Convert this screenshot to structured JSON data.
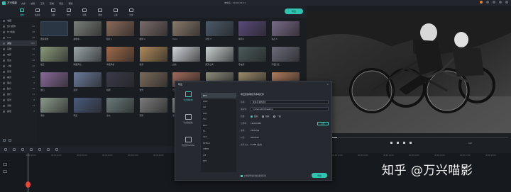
{
  "titlebar": {
    "app_name": "万兴喵影",
    "menus": [
      "文件",
      "编辑",
      "工具",
      "查看",
      "导出",
      "帮助"
    ],
    "project_title": "未命名 : 00:00:03:01"
  },
  "toolbar": {
    "tools": [
      {
        "label": "媒体",
        "icon": "media-icon"
      },
      {
        "label": "素材库",
        "icon": "library-icon"
      },
      {
        "label": "音频",
        "icon": "music-icon"
      },
      {
        "label": "文字",
        "icon": "text-icon"
      },
      {
        "label": "转场",
        "icon": "transition-icon"
      },
      {
        "label": "特效",
        "icon": "effects-icon"
      },
      {
        "label": "元素",
        "icon": "elements-icon"
      },
      {
        "label": "分屏",
        "icon": "split-screen-icon"
      }
    ],
    "active_tool": 0,
    "export_label": "导出"
  },
  "sidebar": {
    "items": [
      {
        "label": "收藏",
        "count": ""
      },
      {
        "label": "热门推荐",
        "count": "10"
      },
      {
        "label": "DIY模板",
        "count": "38"
      },
      {
        "label": "LUT",
        "count": "38"
      },
      {
        "label": "滤镜",
        "count": "186"
      },
      {
        "label": "基础",
        "count": "12"
      },
      {
        "label": "电影",
        "count": "15"
      },
      {
        "label": "复古",
        "count": "18"
      },
      {
        "label": "人像",
        "count": "10"
      },
      {
        "label": "风景",
        "count": "18"
      },
      {
        "label": "美食",
        "count": "12"
      },
      {
        "label": "黑白",
        "count": "9"
      },
      {
        "label": "胶片",
        "count": "16"
      },
      {
        "label": "旅行",
        "count": "11"
      },
      {
        "label": "夜景",
        "count": "8"
      },
      {
        "label": "清新",
        "count": "14"
      },
      {
        "label": "其他",
        "count": "7"
      }
    ],
    "selected": 4
  },
  "grid": {
    "items": [
      {
        "caption": "更多特效",
        "color": "#2a3a4a"
      },
      {
        "caption": "拍摄中...",
        "color": "#7a7f7a"
      },
      {
        "caption": "胶片 1",
        "color": "#8a6a5a"
      },
      {
        "caption": "暖调 2",
        "color": "#7a6a6a"
      },
      {
        "caption": "Vivid",
        "color": "#8a7a6a"
      },
      {
        "caption": "冷色 3",
        "color": "#4a5a6a"
      },
      {
        "caption": "紫调 4",
        "color": "#5a4a7a"
      },
      {
        "caption": "复古 5",
        "color": "#7a6a8a"
      },
      {
        "caption": "夏日",
        "color": "#8a9a7a"
      },
      {
        "caption": "晴朗风光",
        "color": "#9aa4a8"
      },
      {
        "caption": "青橙风格",
        "color": "#a06a4a"
      },
      {
        "caption": "暖黄",
        "color": "#b08a5a"
      },
      {
        "caption": "白色",
        "color": "#d0d4d8"
      },
      {
        "caption": "雨天心情",
        "color": "#c8d0d0"
      },
      {
        "caption": "老电影",
        "color": "#4a5a5a"
      },
      {
        "caption": "午夜灯光",
        "color": "#6a6a7a"
      },
      {
        "caption": "迷幻",
        "color": "#8a6a9a"
      },
      {
        "caption": "蓝调",
        "color": "#6a7a9a"
      },
      {
        "caption": "暗调",
        "color": "#3a3a4a"
      },
      {
        "caption": "逆光",
        "color": "#7a6a5a"
      },
      {
        "caption": "日落 2",
        "color": "#a06a5a"
      },
      {
        "caption": "旅行",
        "color": "#8a8a7a"
      },
      {
        "caption": "怀旧印记",
        "color": "#9a8a6a"
      },
      {
        "caption": "暖阳",
        "color": "#b07a5a"
      },
      {
        "caption": "清新",
        "color": "#8a9a8a"
      },
      {
        "caption": "深蓝",
        "color": "#4a5a7a"
      },
      {
        "caption": "冷淡",
        "color": "#6a7a7a"
      },
      {
        "caption": "灰调",
        "color": "#7a7a7a"
      },
      {
        "caption": "黑白 1",
        "color": "#a0a0a0"
      },
      {
        "caption": "黑白 2",
        "color": "#8a8a8a"
      },
      {
        "caption": "黑白 3",
        "color": "#9a9a9a"
      },
      {
        "caption": "黑白 4",
        "color": "#888888"
      }
    ]
  },
  "preview": {
    "aspect": "1/2",
    "progress": 0.14
  },
  "timeline": {
    "ticks": [
      "00:00:00:00",
      "00:00:01:00",
      "00:00:02:00",
      "00:00:03:00",
      "00:00:04:00",
      "00:00:05:00",
      "00:00:06:00",
      "00:00:07:00",
      "00:00:08:00",
      "00:00:09:00",
      "00:00:10:00",
      "00:00:11:00",
      "00:00:12:00",
      "00:00:13:00",
      "00:00:14:00",
      "00:00:15:00",
      "00:00:16:00",
      "00:00:17:00",
      "00:00:18:00"
    ]
  },
  "dialog": {
    "title": "导出",
    "close": "×",
    "nav": [
      {
        "label": "导出到本地",
        "icon": "monitor-icon"
      },
      {
        "label": "导出到设备",
        "icon": "device-icon"
      },
      {
        "label": "导出到YouTube",
        "icon": "upload-icon"
      }
    ],
    "formats": [
      "MP4",
      "WMV",
      "AVI",
      "MOV",
      "F4V",
      "MKV",
      "TS",
      "3GP",
      "MPEG-2",
      "WEBM",
      "GIF",
      "MP3"
    ],
    "selected_format": 0,
    "header": "导出您的项目为本地文件",
    "rows": {
      "name_key": "名称:",
      "name_value": "未命名:我的影片",
      "save_key": "保存到:",
      "save_value": "C:/Users/XXX/Desktop",
      "quality_key": "质量:",
      "quality_options": [
        "最好",
        "较好",
        "一般"
      ],
      "quality_selected": 0,
      "resolution_key": "分辨率:",
      "resolution_value": "1920x1080",
      "settings_label": "设置",
      "framerate_key": "帧率:",
      "framerate_value": "25.00 fps",
      "duration_key": "时长:",
      "duration_value": "00:00:03",
      "size_key": "文件大小:",
      "size_value": "6.1MB (估计)"
    },
    "footer": "启用硬件编码加速视频渲染",
    "export_label": "导出"
  },
  "watermark": "知乎 @万兴喵影"
}
